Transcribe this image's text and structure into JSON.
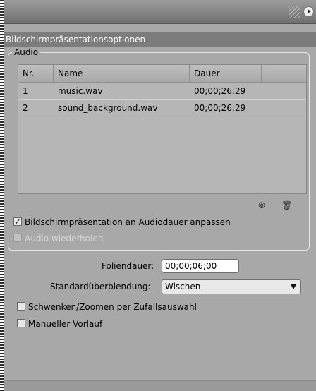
{
  "panel": {
    "section_title": "Bildschirmpräsentationsoptionen"
  },
  "audio_group": {
    "legend": "Audio",
    "table": {
      "columns": [
        "Nr.",
        "Name",
        "Dauer"
      ],
      "rows": [
        {
          "nr": "1",
          "name": "music.wav",
          "dauer": "00;00;26;29"
        },
        {
          "nr": "2",
          "name": "sound_background.wav",
          "dauer": "00;00;26;29"
        }
      ]
    },
    "icons": {
      "replace": "replace-audio-icon",
      "delete": "trash-icon"
    },
    "fit_to_audio": {
      "label": "Bildschirmpräsentation an Audiodauer anpassen",
      "checked": true
    },
    "repeat_audio": {
      "label": "Audio wiederholen",
      "checked": false,
      "disabled": true
    }
  },
  "options": {
    "slide_duration_label": "Foliendauer:",
    "slide_duration_value": "00;00;06;00",
    "transition_label": "Standardüberblendung:",
    "transition_value": "Wischen",
    "pan_zoom": {
      "label": "Schwenken/Zoomen per Zufallsauswahl",
      "checked": false
    },
    "manual_advance": {
      "label": "Manueller Vorlauf",
      "checked": false
    }
  },
  "colors": {
    "panel_bg": "#a8a8a8",
    "header_bg": "#7c7c7c",
    "table_bg": "#b6b6b6"
  }
}
